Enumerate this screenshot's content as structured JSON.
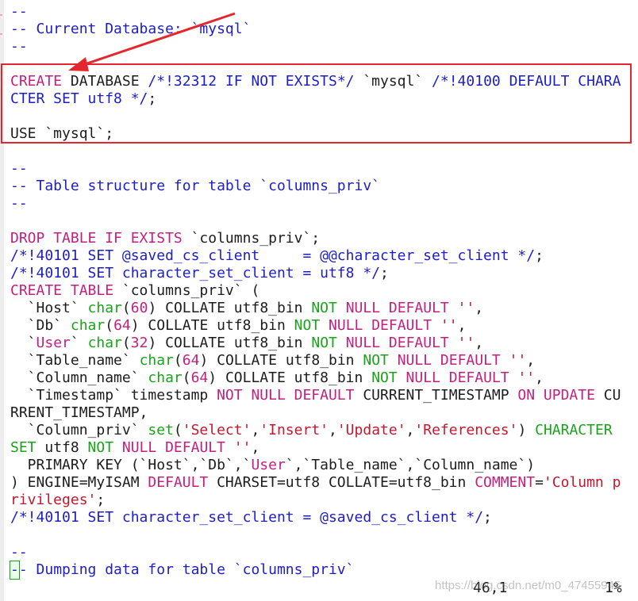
{
  "colors": {
    "comment": "#1d1dc4",
    "keyword": "#c21f7f",
    "string": "#c2182e",
    "type": "#18a418",
    "text": "#1c1c1c",
    "annotation": "#e5262e"
  },
  "code_lines": [
    [
      {
        "t": "--",
        "c": "comment"
      }
    ],
    [
      {
        "t": "-- Current Database: `mysql`",
        "c": "comment"
      }
    ],
    [
      {
        "t": "--",
        "c": "comment"
      }
    ],
    [],
    [
      {
        "t": "CREATE",
        "c": "kw-red"
      },
      {
        "t": " DATABASE ",
        "c": "dark"
      },
      {
        "t": "/*!32312 IF NOT EXISTS*/",
        "c": "comment"
      },
      {
        "t": " `mysql` ",
        "c": "dark"
      },
      {
        "t": "/*!40100 DEFAULT CHARA",
        "c": "comment"
      }
    ],
    [
      {
        "t": "CTER SET utf8 */",
        "c": "comment"
      },
      {
        "t": ";",
        "c": "dark"
      }
    ],
    [],
    [
      {
        "t": "USE `mysql`;",
        "c": "dark"
      }
    ],
    [],
    [
      {
        "t": "--",
        "c": "comment"
      }
    ],
    [
      {
        "t": "-- Table structure for table `columns_priv`",
        "c": "comment"
      }
    ],
    [
      {
        "t": "--",
        "c": "comment"
      }
    ],
    [],
    [
      {
        "t": "DROP TABLE IF EXISTS",
        "c": "kw-red"
      },
      {
        "t": " `columns_priv`;",
        "c": "dark"
      }
    ],
    [
      {
        "t": "/*!40101 SET @saved_cs_client     = @@character_set_client */",
        "c": "comment"
      },
      {
        "t": ";",
        "c": "dark"
      }
    ],
    [
      {
        "t": "/*!40101 SET character_set_client = utf8 */",
        "c": "comment"
      },
      {
        "t": ";",
        "c": "dark"
      }
    ],
    [
      {
        "t": "CREATE TABLE",
        "c": "kw-red"
      },
      {
        "t": " `columns_priv` (",
        "c": "dark"
      }
    ],
    [
      {
        "t": "  `Host` ",
        "c": "dark"
      },
      {
        "t": "char",
        "c": "type"
      },
      {
        "t": "(",
        "c": "dark"
      },
      {
        "t": "60",
        "c": "num"
      },
      {
        "t": ") COLLATE utf8_bin ",
        "c": "dark"
      },
      {
        "t": "NOT",
        "c": "type"
      },
      {
        "t": " ",
        "c": "dark"
      },
      {
        "t": "NULL DEFAULT",
        "c": "kw-red"
      },
      {
        "t": " ",
        "c": "dark"
      },
      {
        "t": "''",
        "c": "str"
      },
      {
        "t": ",",
        "c": "dark"
      }
    ],
    [
      {
        "t": "  `Db` ",
        "c": "dark"
      },
      {
        "t": "char",
        "c": "type"
      },
      {
        "t": "(",
        "c": "dark"
      },
      {
        "t": "64",
        "c": "num"
      },
      {
        "t": ") COLLATE utf8_bin ",
        "c": "dark"
      },
      {
        "t": "NOT",
        "c": "type"
      },
      {
        "t": " ",
        "c": "dark"
      },
      {
        "t": "NULL DEFAULT",
        "c": "kw-red"
      },
      {
        "t": " ",
        "c": "dark"
      },
      {
        "t": "''",
        "c": "str"
      },
      {
        "t": ",",
        "c": "dark"
      }
    ],
    [
      {
        "t": "  `",
        "c": "dark"
      },
      {
        "t": "User",
        "c": "kw-red"
      },
      {
        "t": "` ",
        "c": "dark"
      },
      {
        "t": "char",
        "c": "type"
      },
      {
        "t": "(",
        "c": "dark"
      },
      {
        "t": "32",
        "c": "num"
      },
      {
        "t": ") COLLATE utf8_bin ",
        "c": "dark"
      },
      {
        "t": "NOT",
        "c": "type"
      },
      {
        "t": " ",
        "c": "dark"
      },
      {
        "t": "NULL DEFAULT",
        "c": "kw-red"
      },
      {
        "t": " ",
        "c": "dark"
      },
      {
        "t": "''",
        "c": "str"
      },
      {
        "t": ",",
        "c": "dark"
      }
    ],
    [
      {
        "t": "  `Table_name` ",
        "c": "dark"
      },
      {
        "t": "char",
        "c": "type"
      },
      {
        "t": "(",
        "c": "dark"
      },
      {
        "t": "64",
        "c": "num"
      },
      {
        "t": ") COLLATE utf8_bin ",
        "c": "dark"
      },
      {
        "t": "NOT",
        "c": "type"
      },
      {
        "t": " ",
        "c": "dark"
      },
      {
        "t": "NULL DEFAULT",
        "c": "kw-red"
      },
      {
        "t": " ",
        "c": "dark"
      },
      {
        "t": "''",
        "c": "str"
      },
      {
        "t": ",",
        "c": "dark"
      }
    ],
    [
      {
        "t": "  `Column_name` ",
        "c": "dark"
      },
      {
        "t": "char",
        "c": "type"
      },
      {
        "t": "(",
        "c": "dark"
      },
      {
        "t": "64",
        "c": "num"
      },
      {
        "t": ") COLLATE utf8_bin ",
        "c": "dark"
      },
      {
        "t": "NOT",
        "c": "type"
      },
      {
        "t": " ",
        "c": "dark"
      },
      {
        "t": "NULL DEFAULT",
        "c": "kw-red"
      },
      {
        "t": " ",
        "c": "dark"
      },
      {
        "t": "''",
        "c": "str"
      },
      {
        "t": ",",
        "c": "dark"
      }
    ],
    [
      {
        "t": "  `Timestamp` timestamp ",
        "c": "dark"
      },
      {
        "t": "NOT NULL DEFAULT",
        "c": "kw-red"
      },
      {
        "t": " CURRENT_TIMESTAMP ",
        "c": "dark"
      },
      {
        "t": "ON UPDATE",
        "c": "kw-red"
      },
      {
        "t": " CU",
        "c": "dark"
      }
    ],
    [
      {
        "t": "RRENT_TIMESTAMP,",
        "c": "dark"
      }
    ],
    [
      {
        "t": "  `Column_priv` ",
        "c": "dark"
      },
      {
        "t": "set",
        "c": "type"
      },
      {
        "t": "(",
        "c": "dark"
      },
      {
        "t": "'Select'",
        "c": "str"
      },
      {
        "t": ",",
        "c": "dark"
      },
      {
        "t": "'Insert'",
        "c": "str"
      },
      {
        "t": ",",
        "c": "dark"
      },
      {
        "t": "'Update'",
        "c": "str"
      },
      {
        "t": ",",
        "c": "dark"
      },
      {
        "t": "'References'",
        "c": "str"
      },
      {
        "t": ") ",
        "c": "dark"
      },
      {
        "t": "CHARACTER",
        "c": "type"
      }
    ],
    [
      {
        "t": "SET",
        "c": "type"
      },
      {
        "t": " utf8 ",
        "c": "dark"
      },
      {
        "t": "NOT",
        "c": "type"
      },
      {
        "t": " ",
        "c": "dark"
      },
      {
        "t": "NULL DEFAULT",
        "c": "kw-red"
      },
      {
        "t": " ",
        "c": "dark"
      },
      {
        "t": "''",
        "c": "str"
      },
      {
        "t": ",",
        "c": "dark"
      }
    ],
    [
      {
        "t": "  PRIMARY KEY (`Host`,`Db`,`",
        "c": "dark"
      },
      {
        "t": "User",
        "c": "kw-red"
      },
      {
        "t": "`,`Table_name`,`Column_name`)",
        "c": "dark"
      }
    ],
    [
      {
        "t": ") ENGINE=MyISAM ",
        "c": "dark"
      },
      {
        "t": "DEFAULT",
        "c": "kw-red"
      },
      {
        "t": " CHARSET=utf8 COLLATE=utf8_bin ",
        "c": "dark"
      },
      {
        "t": "COMMENT",
        "c": "kw-red"
      },
      {
        "t": "=",
        "c": "dark"
      },
      {
        "t": "'Column p",
        "c": "str"
      }
    ],
    [
      {
        "t": "rivileges'",
        "c": "str"
      },
      {
        "t": ";",
        "c": "dark"
      }
    ],
    [
      {
        "t": "/*!40101 SET character_set_client = @saved_cs_client */",
        "c": "comment"
      },
      {
        "t": ";",
        "c": "dark"
      }
    ],
    [],
    [
      {
        "t": "--",
        "c": "comment"
      }
    ],
    [
      {
        "t": "-",
        "c": "comment",
        "cursor": true
      },
      {
        "t": "- Dumping data for table `columns_priv`",
        "c": "comment"
      }
    ]
  ],
  "status": {
    "position": "46,1",
    "percent": "1%"
  },
  "watermark": "https://blog.csdn.net/m0_47455945"
}
